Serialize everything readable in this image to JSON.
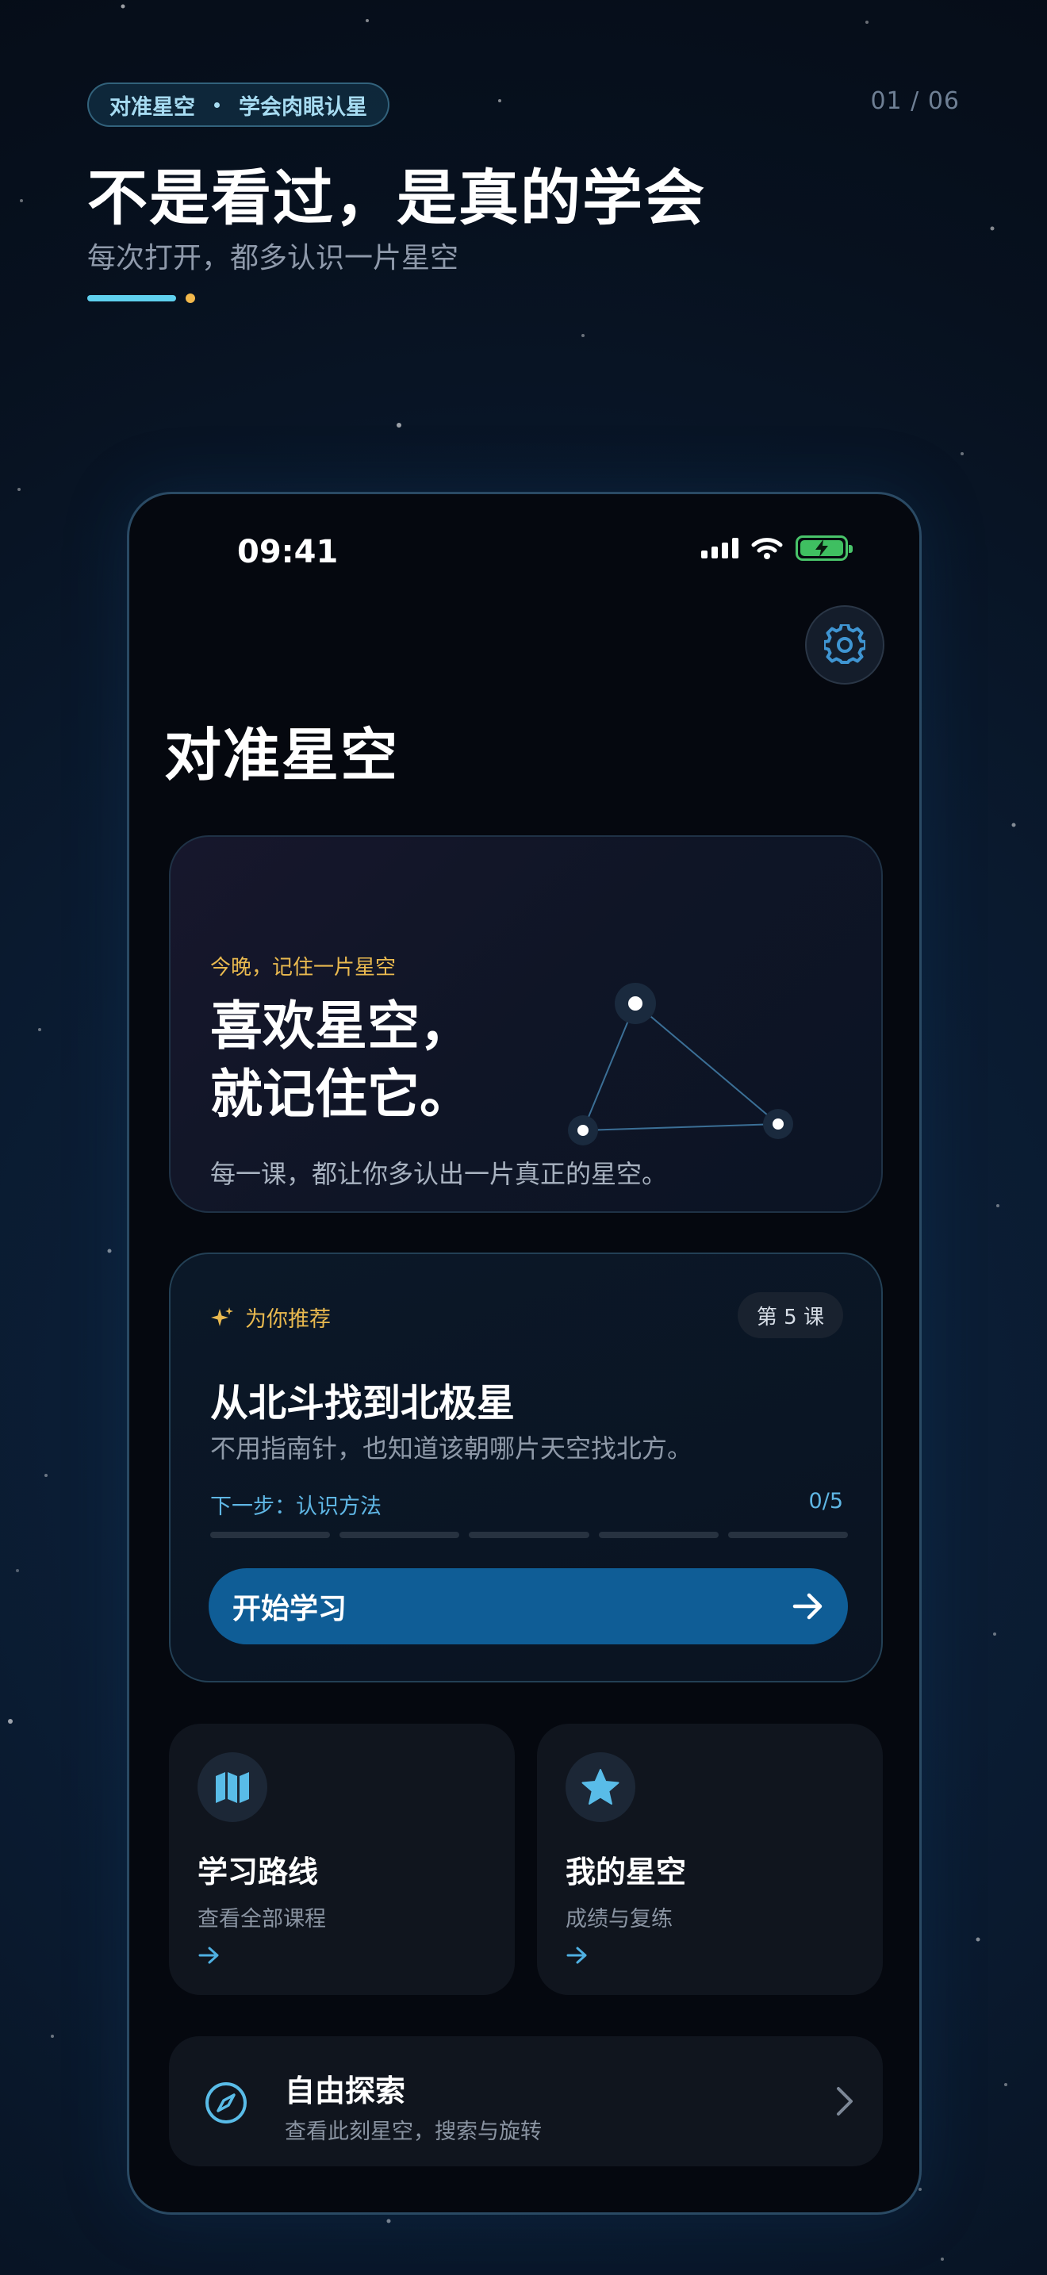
{
  "header": {
    "pill_left": "对准星空",
    "pill_right": "学会肉眼认星",
    "page_indicator": "01 / 06",
    "title": "不是看过，是真的学会",
    "subtitle": "每次打开，都多认识一片星空"
  },
  "status_bar": {
    "time": "09:41"
  },
  "app": {
    "title": "对准星空",
    "hero_card": {
      "eyebrow": "今晚，记住一片星空",
      "headline_line1": "喜欢星空，",
      "headline_line2": "就记住它。",
      "description": "每一课，都让你多认出一片真正的星空。"
    },
    "recommendation": {
      "tag": "为你推荐",
      "lesson_badge": "第 5 课",
      "title": "从北斗找到北极星",
      "description": "不用指南针，也知道该朝哪片天空找北方。",
      "next_step": "下一步：认识方法",
      "progress_text": "0/5",
      "progress_fraction": 0,
      "button_label": "开始学习"
    },
    "tiles": [
      {
        "title": "学习路线",
        "subtitle": "查看全部课程",
        "icon": "map-icon"
      },
      {
        "title": "我的星空",
        "subtitle": "成绩与复练",
        "icon": "star-icon"
      }
    ],
    "explore": {
      "title": "自由探索",
      "subtitle": "查看此刻星空，搜索与旋转",
      "icon": "compass-icon"
    }
  },
  "colors": {
    "accent_blue": "#0f5d96",
    "accent_cyan": "#5fd0ee",
    "accent_gold": "#e9b94f",
    "battery_green": "#3fbf61"
  }
}
